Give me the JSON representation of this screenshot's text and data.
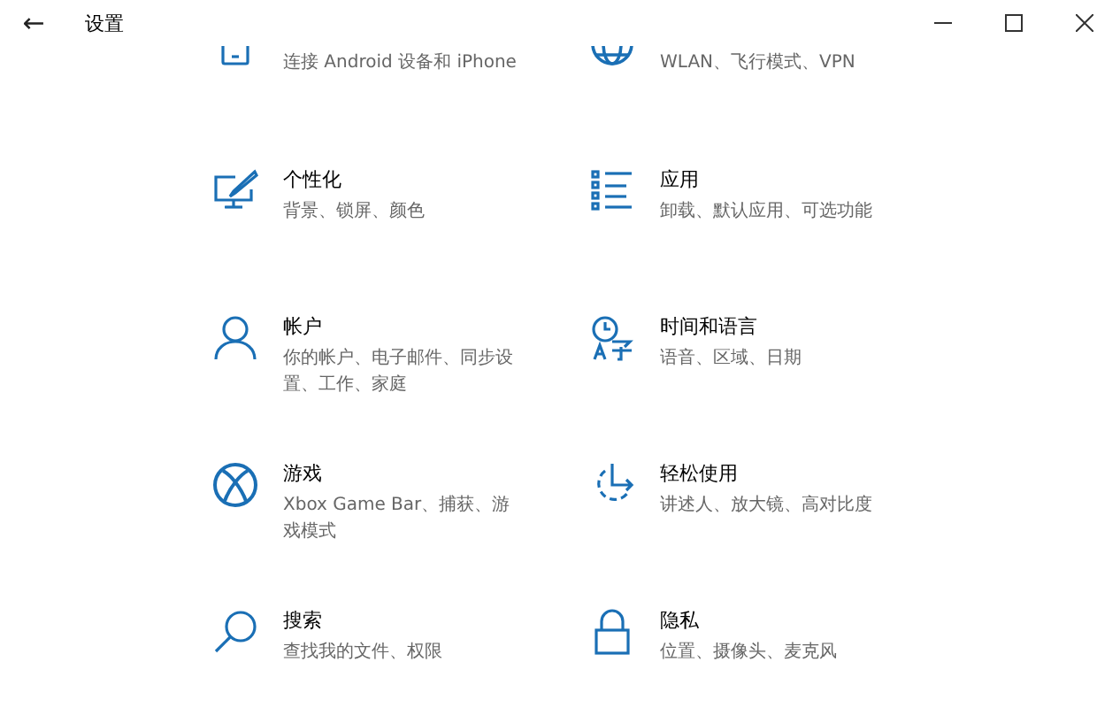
{
  "window": {
    "title": "设置",
    "back": "←"
  },
  "top_row": [
    {
      "description": "连接 Android 设备和 iPhone"
    },
    {
      "description": "WLAN、飞行模式、VPN"
    }
  ],
  "tiles": [
    {
      "title": "个性化",
      "description": "背景、锁屏、颜色"
    },
    {
      "title": "应用",
      "description": "卸载、默认应用、可选功能"
    },
    {
      "title": "帐户",
      "description": "你的帐户、电子邮件、同步设置、工作、家庭"
    },
    {
      "title": "时间和语言",
      "description": "语音、区域、日期"
    },
    {
      "title": "游戏",
      "description": "Xbox Game Bar、捕获、游戏模式"
    },
    {
      "title": "轻松使用",
      "description": "讲述人、放大镜、高对比度"
    },
    {
      "title": "搜索",
      "description": "查找我的文件、权限"
    },
    {
      "title": "隐私",
      "description": "位置、摄像头、麦克风"
    }
  ]
}
